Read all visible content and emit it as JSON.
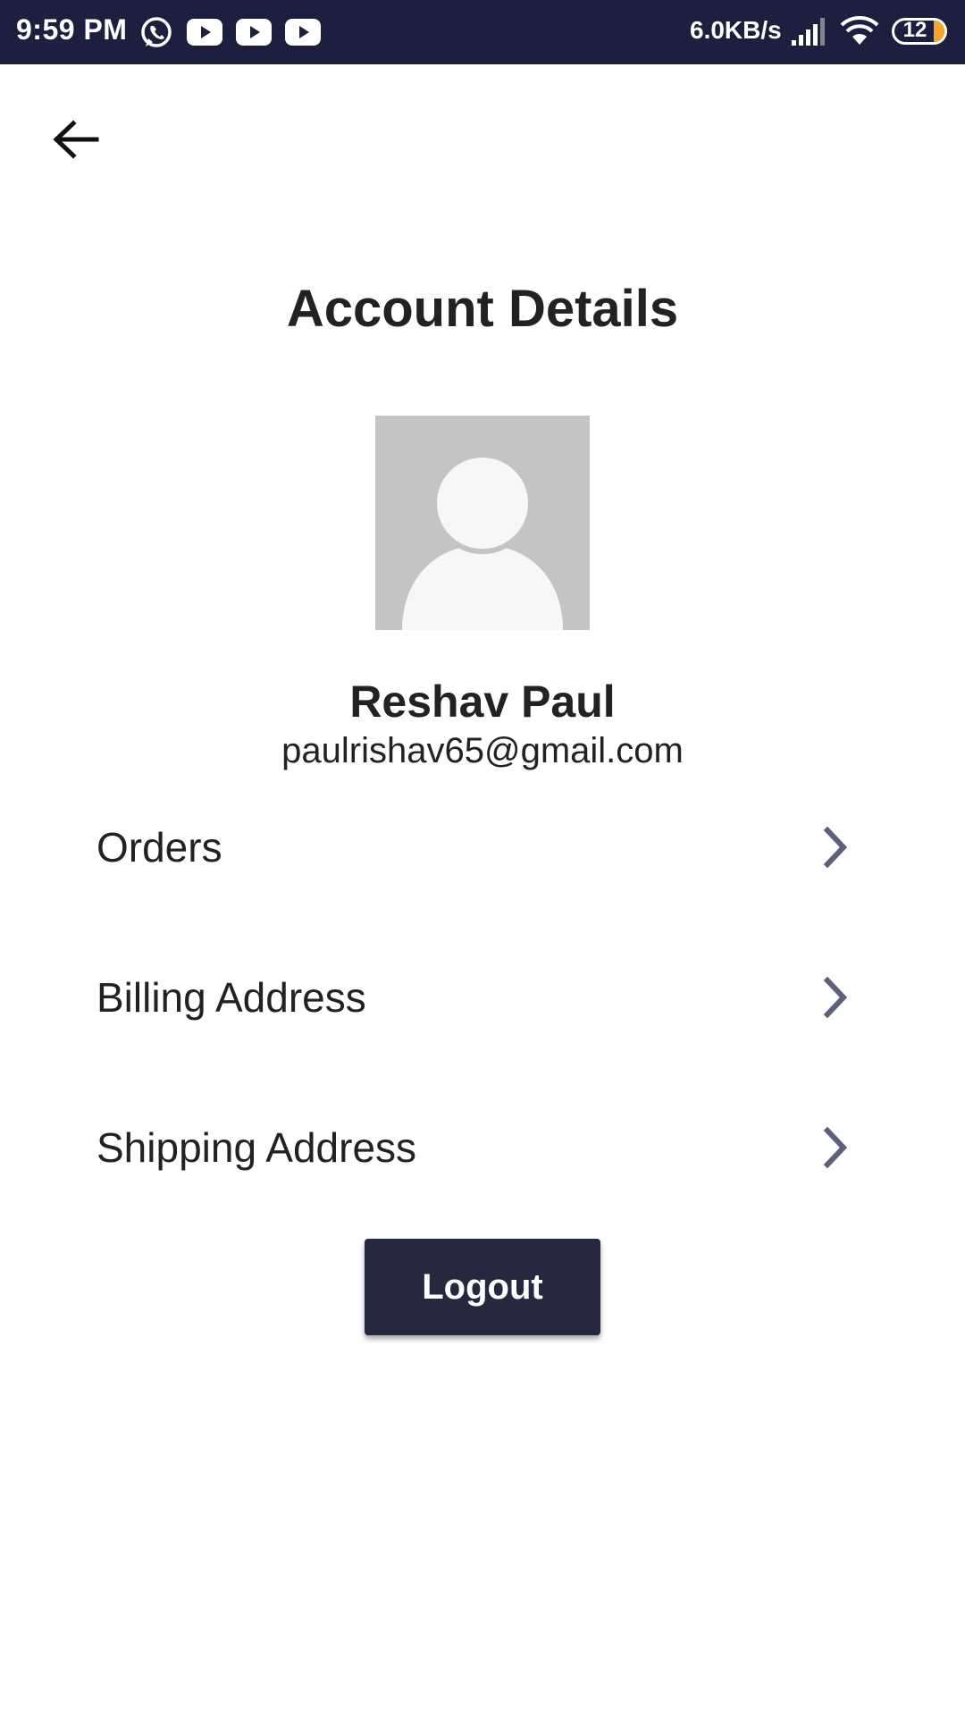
{
  "status_bar": {
    "time": "9:59 PM",
    "net_speed": "6.0KB/s",
    "battery": "12",
    "notification_icons": [
      "whatsapp-icon",
      "youtube-icon",
      "youtube-icon",
      "youtube-icon"
    ],
    "system_icons": [
      "signal-icon",
      "wifi-icon",
      "battery-icon"
    ],
    "background_color": "#1d1f3e"
  },
  "header": {
    "back_icon": "arrow-left-icon"
  },
  "page": {
    "title": "Account Details"
  },
  "profile": {
    "avatar_icon": "avatar-placeholder-icon",
    "name": "Reshav Paul",
    "email": "paulrishav65@gmail.com"
  },
  "menu": {
    "items": [
      {
        "label": "Orders",
        "icon": "chevron-right-icon"
      },
      {
        "label": "Billing Address",
        "icon": "chevron-right-icon"
      },
      {
        "label": "Shipping Address",
        "icon": "chevron-right-icon"
      }
    ]
  },
  "actions": {
    "logout_label": "Logout",
    "button_color": "#26283f",
    "chevron_color": "#5e6079"
  }
}
